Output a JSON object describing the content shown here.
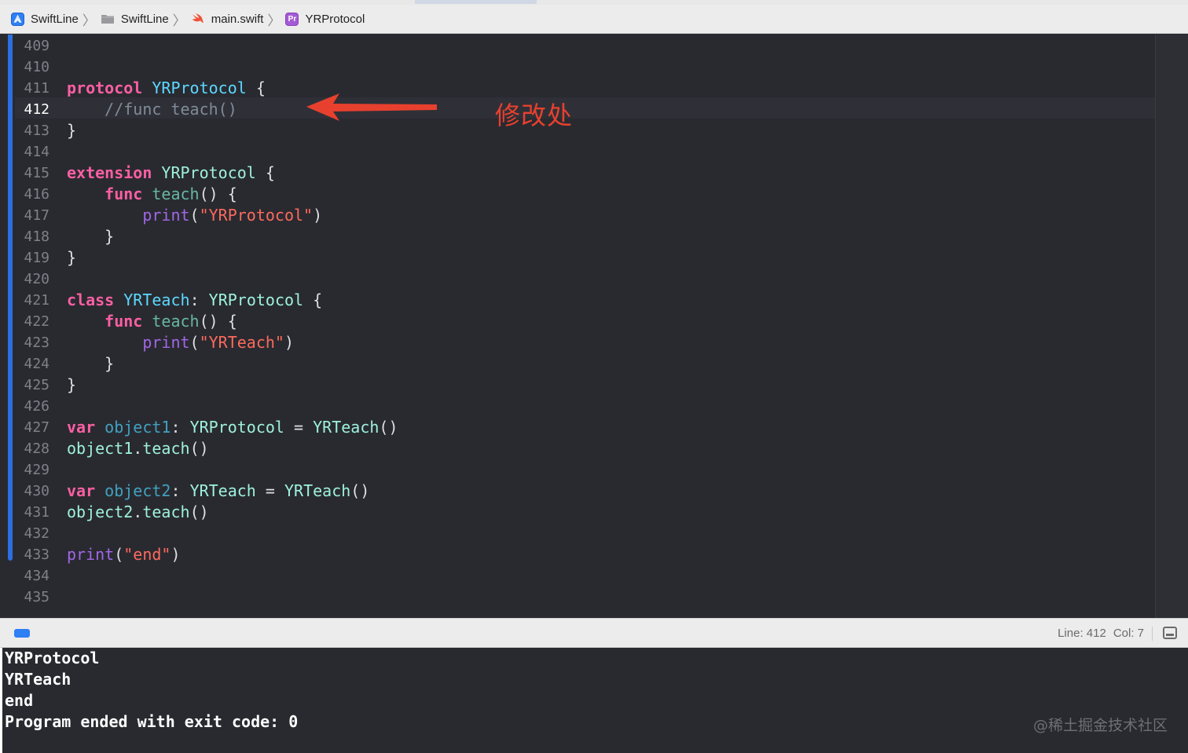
{
  "breadcrumb": {
    "items": [
      {
        "label": "SwiftLine",
        "icon": "xcode-project-icon"
      },
      {
        "label": "SwiftLine",
        "icon": "folder-icon"
      },
      {
        "label": "main.swift",
        "icon": "swift-file-icon"
      },
      {
        "label": "YRProtocol",
        "icon": "protocol-icon",
        "badge": "Pr"
      }
    ],
    "separator": "〉"
  },
  "editor": {
    "current_line": 412,
    "line_numbers": [
      "409",
      "410",
      "411",
      "412",
      "413",
      "414",
      "415",
      "416",
      "417",
      "418",
      "419",
      "420",
      "421",
      "422",
      "423",
      "424",
      "425",
      "426",
      "427",
      "428",
      "429",
      "430",
      "431",
      "432",
      "433",
      "434",
      "435"
    ],
    "code_lines": [
      [],
      [],
      [
        {
          "t": "protocol",
          "c": "kw"
        },
        {
          "t": " ",
          "c": ""
        },
        {
          "t": "YRProtocol",
          "c": "ty"
        },
        {
          "t": " {",
          "c": ""
        }
      ],
      [
        {
          "t": "    //func teach()",
          "c": "cm"
        }
      ],
      [
        {
          "t": "}",
          "c": ""
        }
      ],
      [],
      [
        {
          "t": "extension",
          "c": "kw"
        },
        {
          "t": " ",
          "c": ""
        },
        {
          "t": "YRProtocol",
          "c": "tu"
        },
        {
          "t": " {",
          "c": ""
        }
      ],
      [
        {
          "t": "    ",
          "c": ""
        },
        {
          "t": "func",
          "c": "kw"
        },
        {
          "t": " ",
          "c": ""
        },
        {
          "t": "teach",
          "c": "fn"
        },
        {
          "t": "() {",
          "c": ""
        }
      ],
      [
        {
          "t": "        ",
          "c": ""
        },
        {
          "t": "print",
          "c": "pf"
        },
        {
          "t": "(",
          "c": ""
        },
        {
          "t": "\"YRProtocol\"",
          "c": "st"
        },
        {
          "t": ")",
          "c": ""
        }
      ],
      [
        {
          "t": "    }",
          "c": ""
        }
      ],
      [
        {
          "t": "}",
          "c": ""
        }
      ],
      [],
      [
        {
          "t": "class",
          "c": "kw"
        },
        {
          "t": " ",
          "c": ""
        },
        {
          "t": "YRTeach",
          "c": "ty"
        },
        {
          "t": ": ",
          "c": ""
        },
        {
          "t": "YRProtocol",
          "c": "tu"
        },
        {
          "t": " {",
          "c": ""
        }
      ],
      [
        {
          "t": "    ",
          "c": ""
        },
        {
          "t": "func",
          "c": "kw"
        },
        {
          "t": " ",
          "c": ""
        },
        {
          "t": "teach",
          "c": "fn"
        },
        {
          "t": "() {",
          "c": ""
        }
      ],
      [
        {
          "t": "        ",
          "c": ""
        },
        {
          "t": "print",
          "c": "pf"
        },
        {
          "t": "(",
          "c": ""
        },
        {
          "t": "\"YRTeach\"",
          "c": "st"
        },
        {
          "t": ")",
          "c": ""
        }
      ],
      [
        {
          "t": "    }",
          "c": ""
        }
      ],
      [
        {
          "t": "}",
          "c": ""
        }
      ],
      [],
      [
        {
          "t": "var",
          "c": "kw"
        },
        {
          "t": " ",
          "c": ""
        },
        {
          "t": "object1",
          "c": "vr"
        },
        {
          "t": ": ",
          "c": ""
        },
        {
          "t": "YRProtocol",
          "c": "ur"
        },
        {
          "t": " = ",
          "c": ""
        },
        {
          "t": "YRTeach",
          "c": "ur"
        },
        {
          "t": "()",
          "c": ""
        }
      ],
      [
        {
          "t": "object1",
          "c": "ur"
        },
        {
          "t": ".",
          "c": ""
        },
        {
          "t": "teach",
          "c": "ur"
        },
        {
          "t": "()",
          "c": ""
        }
      ],
      [],
      [
        {
          "t": "var",
          "c": "kw"
        },
        {
          "t": " ",
          "c": ""
        },
        {
          "t": "object2",
          "c": "vr"
        },
        {
          "t": ": ",
          "c": ""
        },
        {
          "t": "YRTeach",
          "c": "ur"
        },
        {
          "t": " = ",
          "c": ""
        },
        {
          "t": "YRTeach",
          "c": "ur"
        },
        {
          "t": "()",
          "c": ""
        }
      ],
      [
        {
          "t": "object2",
          "c": "ur"
        },
        {
          "t": ".",
          "c": ""
        },
        {
          "t": "teach",
          "c": "ur"
        },
        {
          "t": "()",
          "c": ""
        }
      ],
      [],
      [
        {
          "t": "print",
          "c": "pf"
        },
        {
          "t": "(",
          "c": ""
        },
        {
          "t": "\"end\"",
          "c": "st"
        },
        {
          "t": ")",
          "c": ""
        }
      ],
      [],
      []
    ]
  },
  "annotation": {
    "text": "修改处",
    "color": "#e8402e"
  },
  "status": {
    "line": "Line: 412",
    "col": "Col: 7"
  },
  "console": {
    "lines": [
      "YRProtocol",
      "YRTeach",
      "end",
      "Program ended with exit code: 0"
    ],
    "watermark": "@稀土掘金技术社区"
  }
}
